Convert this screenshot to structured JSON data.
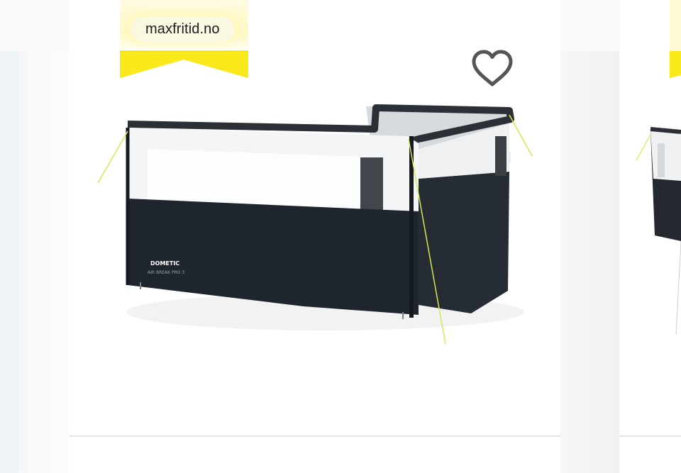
{
  "store": {
    "name": "maxfritid.no"
  },
  "product_card": {
    "favorite": {
      "icon": "heart-outline-icon",
      "state": "not-favorited"
    },
    "image": {
      "brand_text": "DOMETIC",
      "model_text": "AIR BREAK PRO 3"
    }
  },
  "colors": {
    "ribbon": "#f9e81a",
    "ribbon_edge": "#e6d300",
    "chip_background": "#fbf8e2",
    "heart_stroke": "#555555",
    "tent_dark": "#1e252c",
    "tent_frame": "#2a3036",
    "guy_line": "#d9e84a"
  }
}
